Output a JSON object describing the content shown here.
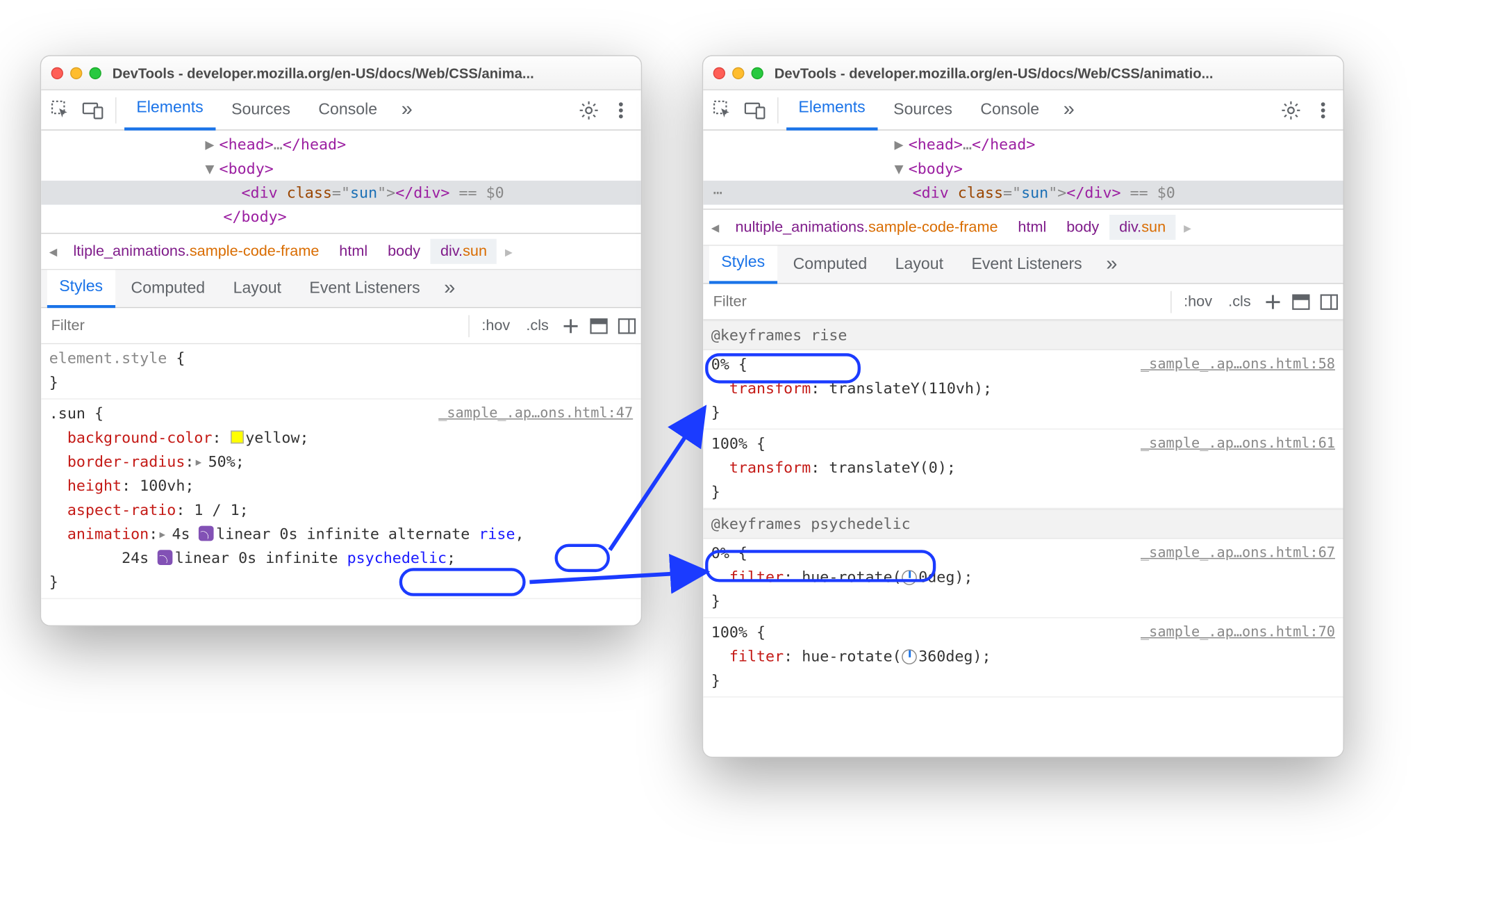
{
  "windows": {
    "left": {
      "title": "DevTools - developer.mozilla.org/en-US/docs/Web/CSS/anima...",
      "tabs": {
        "elements": "Elements",
        "sources": "Sources",
        "console": "Console"
      },
      "dom": {
        "head_open": "<head>",
        "head_ell": "…",
        "head_close": "</head>",
        "body_open": "<body>",
        "div_open": "<div ",
        "div_class_attr": "class",
        "div_class_eq": "=\"",
        "div_class_val": "sun",
        "div_close_quote": "\">",
        "div_end": "</div>",
        "eq0": " == $0",
        "body_close": "</body>"
      },
      "breadcrumb": {
        "scroll_left": "◂",
        "item0_pre": "ltiple_animations.",
        "item0_orange": "sample-code-frame",
        "item1": "html",
        "item2": "body",
        "item3_pre": "div.",
        "item3_orange": "sun",
        "scroll_right": "▸"
      },
      "subtabs": {
        "styles": "Styles",
        "computed": "Computed",
        "layout": "Layout",
        "listeners": "Event Listeners"
      },
      "filter": {
        "placeholder": "Filter",
        "hov": ":hov",
        "cls": ".cls"
      },
      "styles": {
        "element_style_sel": "element.style",
        "open": " {",
        "close": "}",
        "sun_sel": ".sun",
        "sun_loc": "_sample_.ap…ons.html:47",
        "p_bg": "background-color",
        "v_bg": "yellow",
        "p_br": "border-radius",
        "v_br": "50%",
        "p_h": "height",
        "v_h": "100vh",
        "p_ar": "aspect-ratio",
        "v_ar": "1 / 1",
        "p_anim": "animation",
        "v_anim1_pre": "4s ",
        "v_anim1_mid": "linear 0s infinite alternate ",
        "v_anim1_name": "rise",
        "v_anim2_pre": "24s ",
        "v_anim2_mid": "linear 0s infinite ",
        "v_anim2_name": "psychedelic",
        "semi": ";"
      }
    },
    "right": {
      "title": "DevTools - developer.mozilla.org/en-US/docs/Web/CSS/animatio...",
      "tabs": {
        "elements": "Elements",
        "sources": "Sources",
        "console": "Console"
      },
      "dom": {
        "head_open": "<head>",
        "head_ell": "…",
        "head_close": "</head>",
        "body_open": "<body>",
        "div_open": "<div ",
        "div_class_attr": "class",
        "div_class_eq": "=\"",
        "div_class_val": "sun",
        "div_close_quote": "\">",
        "div_end": "</div>",
        "eq0": " == $0"
      },
      "breadcrumb": {
        "scroll_left": "◂",
        "item0_pre": "nultiple_animations.",
        "item0_orange": "sample-code-frame",
        "item1": "html",
        "item2": "body",
        "item3_pre": "div.",
        "item3_orange": "sun",
        "scroll_right": "▸"
      },
      "subtabs": {
        "styles": "Styles",
        "computed": "Computed",
        "layout": "Layout",
        "listeners": "Event Listeners"
      },
      "filter": {
        "placeholder": "Filter",
        "hov": ":hov",
        "cls": ".cls"
      },
      "kf": {
        "rise_header": "@keyframes rise",
        "psy_header": "@keyframes psychedelic",
        "pct0": "0% {",
        "pct100": "100% {",
        "close": "}",
        "transform": "transform",
        "translate110": "translateY(110vh)",
        "translate0": "translateY(0)",
        "filter": "filter",
        "hue0": "hue-rotate(",
        "hue0val": "0deg",
        "hue360val": "360deg",
        "paren_close": ")",
        "semi": ";",
        "loc58": "_sample_.ap…ons.html:58",
        "loc61": "_sample_.ap…ons.html:61",
        "loc67": "_sample_.ap…ons.html:67",
        "loc70": "_sample_.ap…ons.html:70"
      }
    }
  }
}
